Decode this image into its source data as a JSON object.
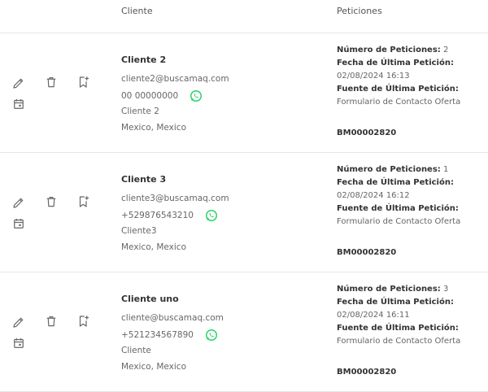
{
  "header": {
    "cliente": "Cliente",
    "peticiones": "Peticiones"
  },
  "labels": {
    "numero": "Número de Peticiones:",
    "fecha": "Fecha de Última Petición:",
    "fuente": "Fuente de Última Petición:"
  },
  "icons": {
    "edit": "pencil-icon",
    "delete": "trash-icon",
    "bookmark": "bookmark-add-icon",
    "calendar": "calendar-icon",
    "whatsapp": "whatsapp-icon"
  },
  "colors": {
    "whatsapp": "#25D366"
  },
  "rows": [
    {
      "name": "Cliente 2",
      "email": "cliente2@buscamaq.com",
      "phone": "00 00000000",
      "company": "Cliente 2",
      "location": "Mexico, Mexico",
      "count": "2",
      "date": "02/08/2024 16:13",
      "source": "Formulario de Contacto Oferta",
      "code": "BM00002820"
    },
    {
      "name": "Cliente 3",
      "email": "cliente3@buscamaq.com",
      "phone": "+529876543210",
      "company": "Cliente3",
      "location": "Mexico, Mexico",
      "count": "1",
      "date": "02/08/2024 16:12",
      "source": "Formulario de Contacto Oferta",
      "code": "BM00002820"
    },
    {
      "name": "Cliente uno",
      "email": "cliente@buscamaq.com",
      "phone": "+521234567890",
      "company": "Cliente",
      "location": "Mexico, Mexico",
      "count": "3",
      "date": "02/08/2024 16:11",
      "source": "Formulario de Contacto Oferta",
      "code": "BM00002820"
    }
  ]
}
